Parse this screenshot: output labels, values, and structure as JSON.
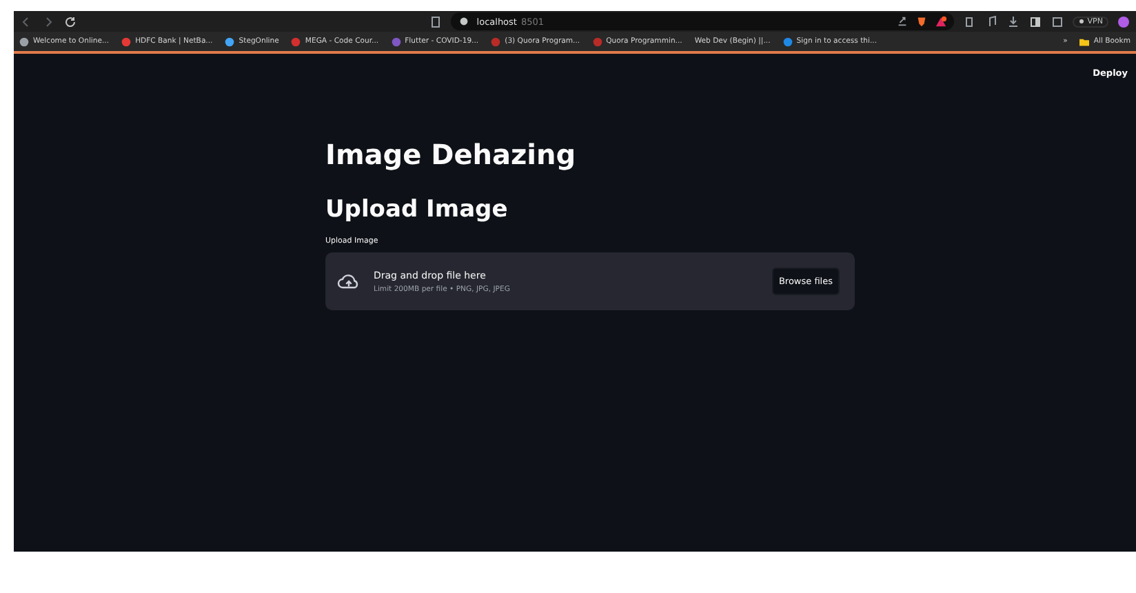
{
  "browser": {
    "url_host": "localhost",
    "url_port": "8501",
    "vpn_label": "VPN",
    "bookmarks": [
      {
        "label": "Welcome to Online...",
        "color": "#9aa0a6"
      },
      {
        "label": "HDFC Bank | NetBa...",
        "color": "#e53935"
      },
      {
        "label": "StegOnline",
        "color": "#42a5f5"
      },
      {
        "label": "MEGA - Code Cour...",
        "color": "#d32f2f"
      },
      {
        "label": "Flutter - COVID-19...",
        "color": "#7e57c2"
      },
      {
        "label": "(3) Quora Program...",
        "color": "#b92b27"
      },
      {
        "label": "Quora Programmin...",
        "color": "#b92b27"
      },
      {
        "label": "Web Dev (Begin) ||..."
      },
      {
        "label": "Sign in to access thi...",
        "color": "#1e88e5"
      }
    ],
    "more": "»",
    "all_bookmarks": "All Bookm"
  },
  "app": {
    "deploy": "Deploy",
    "title": "Image Dehazing",
    "subheader": "Upload Image",
    "uploader": {
      "label": "Upload Image",
      "instruction": "Drag and drop file here",
      "limits": "Limit 200MB per file • PNG, JPG, JPEG",
      "button": "Browse files"
    }
  }
}
